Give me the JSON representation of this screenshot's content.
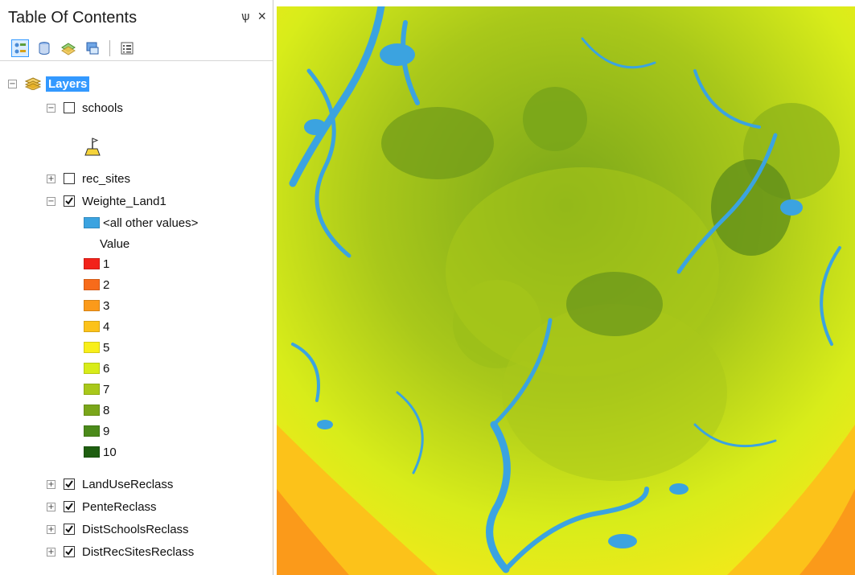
{
  "toc": {
    "title": "Table Of Contents",
    "pin_glyph": "ѱ",
    "close_glyph": "×",
    "toolbar": [
      "list-by-drawing-order",
      "list-by-source",
      "list-by-visibility",
      "list-by-selection",
      "options"
    ],
    "root_label": "Layers",
    "layers": [
      {
        "name": "schools",
        "checked": false,
        "expanded": true
      },
      {
        "name": "rec_sites",
        "checked": false,
        "expanded": false
      },
      {
        "name": "Weighte_Land1",
        "checked": true,
        "expanded": true
      },
      {
        "name": "LandUseReclass",
        "checked": true,
        "expanded": false
      },
      {
        "name": "PenteReclass",
        "checked": true,
        "expanded": false
      },
      {
        "name": "DistSchoolsReclass",
        "checked": true,
        "expanded": false
      },
      {
        "name": "DistRecSitesReclass",
        "checked": true,
        "expanded": false
      }
    ],
    "legend": {
      "other_label": "<all other values>",
      "other_color": "#3ba3e0",
      "value_header": "Value",
      "classes": [
        {
          "label": "1",
          "color": "#f2221a"
        },
        {
          "label": "2",
          "color": "#f76b1a"
        },
        {
          "label": "3",
          "color": "#fb9a1a"
        },
        {
          "label": "4",
          "color": "#fcc21a"
        },
        {
          "label": "5",
          "color": "#f8ef1a"
        },
        {
          "label": "6",
          "color": "#d8ec1a"
        },
        {
          "label": "7",
          "color": "#a9c81a"
        },
        {
          "label": "8",
          "color": "#7aa61a"
        },
        {
          "label": "9",
          "color": "#4b8a1a"
        },
        {
          "label": "10",
          "color": "#1e5e10"
        }
      ]
    }
  },
  "map": {
    "colors": {
      "water": "#3ba3e0",
      "base": "#c4d800"
    }
  }
}
